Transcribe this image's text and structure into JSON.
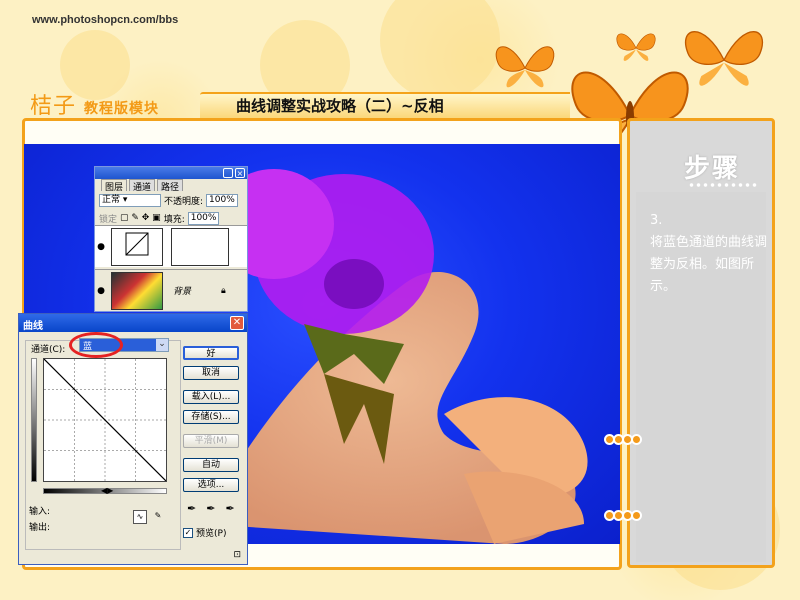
{
  "site": {
    "url": "www.photoshopcn.com/bbs"
  },
  "brand": {
    "name": "桔子",
    "module": "教程版模块"
  },
  "header": {
    "title": "曲线调整实战攻略（二）~反相"
  },
  "step": {
    "title": "步骤",
    "text": "3.\n将蓝色通道的曲线调整为反相。如图所示。"
  },
  "layers_palette": {
    "tabs": [
      "图层",
      "通道",
      "路径"
    ],
    "blend_mode": "正常",
    "opacity_label": "不透明度:",
    "opacity_value": "100%",
    "lock_label": "锁定",
    "fill_label": "填充:",
    "fill_value": "100%",
    "background_layer_name": "背景"
  },
  "curves_dialog": {
    "title": "曲线",
    "channel_label": "通道(C):",
    "channel_value": "蓝",
    "buttons": {
      "ok": "好",
      "cancel": "取消",
      "load": "载入(L)...",
      "save": "存储(S)...",
      "smooth": "平滑(M)",
      "auto": "自动",
      "options": "选项..."
    },
    "input_label": "输入:",
    "output_label": "输出:",
    "preview_label": "预览(P)",
    "preview_checked": true
  },
  "colors": {
    "accent": "#f3a21b",
    "canvas_blue": "#1332ee",
    "dialog_bg": "#ece9d8"
  }
}
